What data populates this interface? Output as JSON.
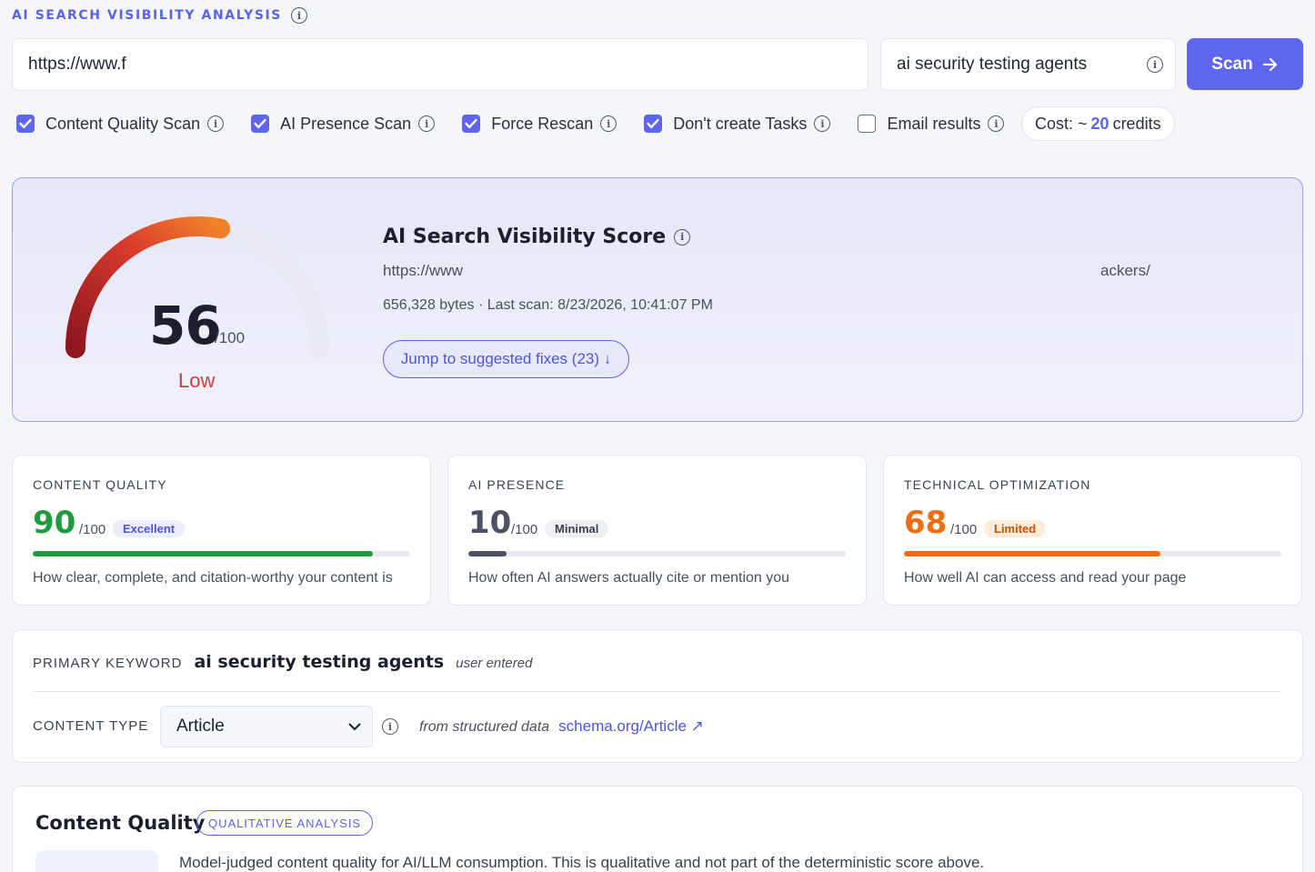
{
  "header": {
    "title": "AI SEARCH VISIBILITY ANALYSIS"
  },
  "scan_form": {
    "url_value": "https://www.f",
    "keyword_value": "ai security testing agents",
    "scan_label": "Scan",
    "options": [
      {
        "label": "Content Quality Scan",
        "checked": true
      },
      {
        "label": "AI Presence Scan",
        "checked": true
      },
      {
        "label": "Force Rescan",
        "checked": true
      },
      {
        "label": "Don't create Tasks",
        "checked": true
      },
      {
        "label": "Email results",
        "checked": false
      }
    ],
    "cost_prefix": "Cost: ~",
    "cost_value": "20",
    "cost_suffix": "credits"
  },
  "score": {
    "value": 56,
    "max_label": "/100",
    "level": "Low",
    "title": "AI Search Visibility Score",
    "url_start": "https://www",
    "url_end": "ackers/",
    "meta": "656,328 bytes · Last scan: 8/23/2026, 10:41:07 PM",
    "jump_label": "Jump to suggested fixes (23) ↓"
  },
  "metrics": [
    {
      "title": "CONTENT QUALITY",
      "value": 90,
      "max_label": "/100",
      "badge": "Excellent",
      "description": "How clear, complete, and citation-worthy your content is",
      "color": "#1e9a3f",
      "badge_bg": "#eceefb",
      "badge_fg": "#4d55d8"
    },
    {
      "title": "AI PRESENCE",
      "value": 10,
      "max_label": "/100",
      "badge": "Minimal",
      "description": "How often AI answers actually cite or mention you",
      "color": "#4b5160",
      "badge_bg": "#eff0f3",
      "badge_fg": "#3a3f4c"
    },
    {
      "title": "TECHNICAL OPTIMIZATION",
      "value": 68,
      "max_label": "/100",
      "badge": "Limited",
      "description": "How well AI can access and read your page",
      "color": "#f06d0f",
      "badge_bg": "#fdecd9",
      "badge_fg": "#c2530a"
    }
  ],
  "keyword_panel": {
    "primary_label": "PRIMARY KEYWORD",
    "primary_value": "ai security testing agents",
    "primary_source": "user entered",
    "content_type_label": "CONTENT TYPE",
    "content_type_value": "Article",
    "content_type_source": "from structured data",
    "schema_link": "schema.org/Article ↗"
  },
  "content_quality": {
    "title": "Content Quality",
    "badge": "QUALITATIVE ANALYSIS",
    "description": "Model-judged content quality for AI/LLM consumption. This is qualitative and not part of the deterministic score above."
  },
  "colors": {
    "accent": "#5e65ee",
    "low": "#d23b3b"
  },
  "icons": [
    "info-icon",
    "arrow-right-icon",
    "checkmark-icon",
    "chevron-down-icon",
    "external-link-icon"
  ]
}
